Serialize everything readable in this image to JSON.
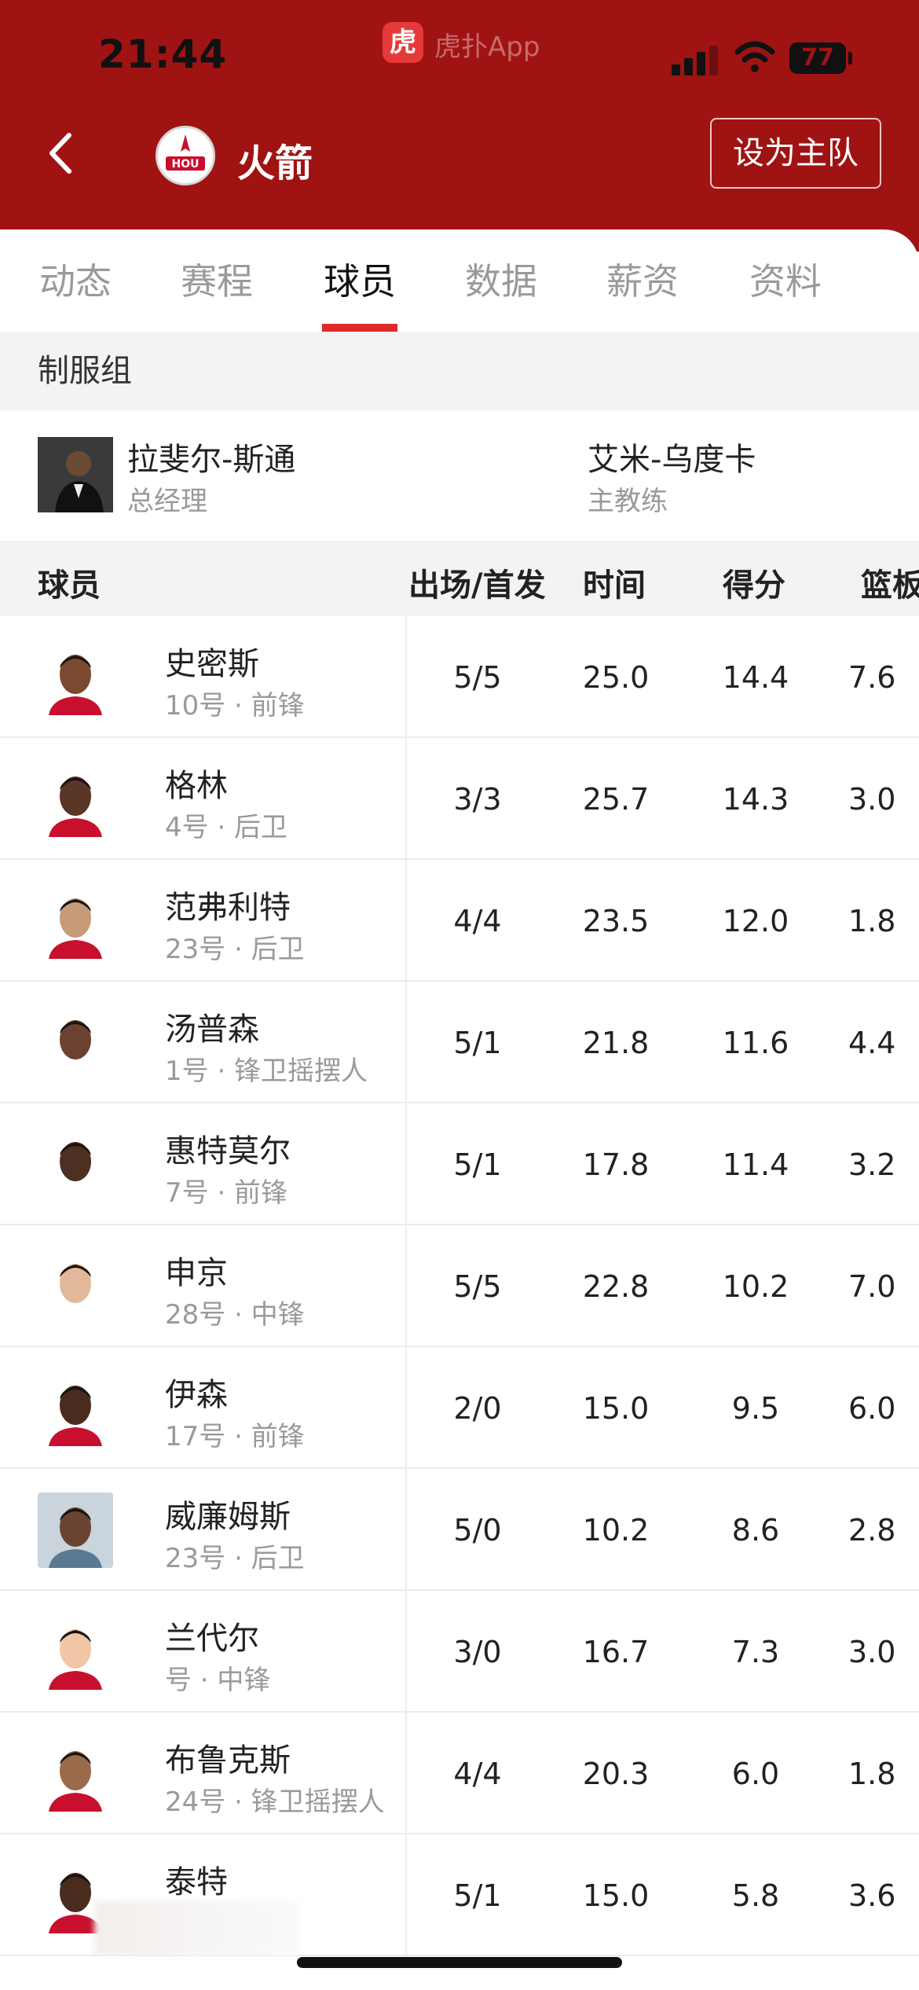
{
  "status_bar": {
    "time": "21:44",
    "app_badge": "虎",
    "app_name": "虎扑App",
    "battery": "77"
  },
  "header": {
    "team_name": "火箭",
    "team_logo_text": "HOU",
    "home_button": "设为主队"
  },
  "tabs": [
    {
      "label": "动态",
      "active": false
    },
    {
      "label": "赛程",
      "active": false
    },
    {
      "label": "球员",
      "active": true
    },
    {
      "label": "数据",
      "active": false
    },
    {
      "label": "薪资",
      "active": false
    },
    {
      "label": "资料",
      "active": false
    }
  ],
  "staff": {
    "title": "制服组",
    "members": [
      {
        "name": "拉斐尔-斯通",
        "role": "总经理"
      },
      {
        "name": "艾米-乌度卡",
        "role": "主教练"
      }
    ]
  },
  "table": {
    "headers": [
      "球员",
      "出场/首发",
      "时间",
      "得分",
      "篮板"
    ],
    "rows": [
      {
        "name": "史密斯",
        "info": "10号 · 前锋",
        "games": "5/5",
        "minutes": "25.0",
        "points": "14.4",
        "rebounds": "7.6"
      },
      {
        "name": "格林",
        "info": "4号 · 后卫",
        "games": "3/3",
        "minutes": "25.7",
        "points": "14.3",
        "rebounds": "3.0"
      },
      {
        "name": "范弗利特",
        "info": "23号 · 后卫",
        "games": "4/4",
        "minutes": "23.5",
        "points": "12.0",
        "rebounds": "1.8"
      },
      {
        "name": "汤普森",
        "info": "1号 · 锋卫摇摆人",
        "games": "5/1",
        "minutes": "21.8",
        "points": "11.6",
        "rebounds": "4.4"
      },
      {
        "name": "惠特莫尔",
        "info": "7号 · 前锋",
        "games": "5/1",
        "minutes": "17.8",
        "points": "11.4",
        "rebounds": "3.2"
      },
      {
        "name": "申京",
        "info": "28号 · 中锋",
        "games": "5/5",
        "minutes": "22.8",
        "points": "10.2",
        "rebounds": "7.0"
      },
      {
        "name": "伊森",
        "info": "17号 · 前锋",
        "games": "2/0",
        "minutes": "15.0",
        "points": "9.5",
        "rebounds": "6.0"
      },
      {
        "name": "威廉姆斯",
        "info": "23号 · 后卫",
        "games": "5/0",
        "minutes": "10.2",
        "points": "8.6",
        "rebounds": "2.8"
      },
      {
        "name": "兰代尔",
        "info": "号 · 中锋",
        "games": "3/0",
        "minutes": "16.7",
        "points": "7.3",
        "rebounds": "3.0"
      },
      {
        "name": "布鲁克斯",
        "info": "24号 · 锋卫摇摆人",
        "games": "4/4",
        "minutes": "20.3",
        "points": "6.0",
        "rebounds": "1.8"
      },
      {
        "name": "泰特",
        "info": "",
        "games": "5/1",
        "minutes": "15.0",
        "points": "5.8",
        "rebounds": "3.6"
      }
    ]
  },
  "colors": {
    "header_bg": "#a01313",
    "tab_indicator": "#e02a2a",
    "section_bg": "#f3f3f5"
  }
}
